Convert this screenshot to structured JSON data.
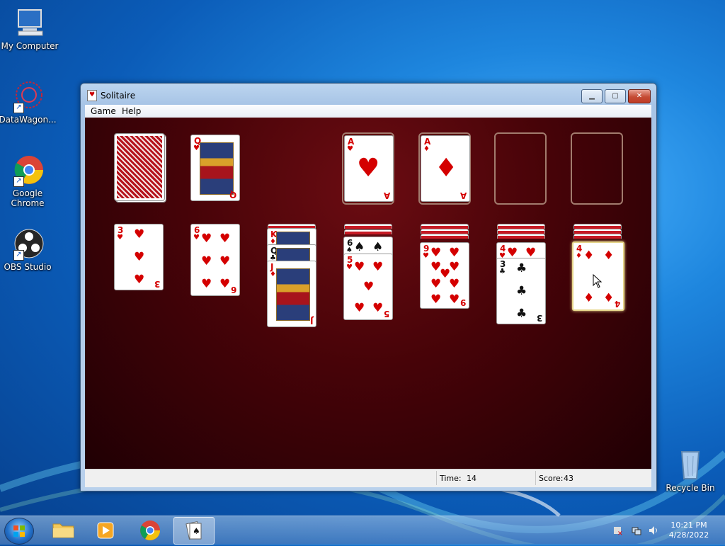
{
  "desktop": {
    "icons": [
      {
        "label": "My Computer"
      },
      {
        "label": "DataWagon..."
      },
      {
        "label": "Google Chrome"
      },
      {
        "label": "OBS Studio"
      },
      {
        "label": "Recycle Bin"
      }
    ]
  },
  "window": {
    "title": "Solitaire",
    "menu": [
      "Game",
      "Help"
    ],
    "controls": {
      "minimize": "▁",
      "maximize": "▢",
      "close": "✕"
    }
  },
  "game": {
    "stock": "face-down deck",
    "waste": {
      "rank": "Q",
      "suit": "♥"
    },
    "foundations": [
      {
        "rank": "A",
        "suit": "♥"
      },
      {
        "rank": "A",
        "suit": "♦"
      },
      null,
      null
    ],
    "tableau": [
      {
        "hidden": 0,
        "up": [
          {
            "rank": "3",
            "suit": "♥"
          }
        ]
      },
      {
        "hidden": 0,
        "up": [
          {
            "rank": "6",
            "suit": "♥"
          }
        ]
      },
      {
        "hidden": 1,
        "up": [
          {
            "rank": "K",
            "suit": "♦"
          },
          {
            "rank": "Q",
            "suit": "♣"
          },
          {
            "rank": "J",
            "suit": "♦"
          }
        ]
      },
      {
        "hidden": 2,
        "up": [
          {
            "rank": "6",
            "suit": "♠"
          },
          {
            "rank": "5",
            "suit": "♥"
          }
        ]
      },
      {
        "hidden": 3,
        "up": [
          {
            "rank": "9",
            "suit": "♥"
          }
        ]
      },
      {
        "hidden": 3,
        "up": [
          {
            "rank": "4",
            "suit": "♥"
          },
          {
            "rank": "3",
            "suit": "♣"
          }
        ]
      },
      {
        "hidden": 3,
        "up": [
          {
            "rank": "4",
            "suit": "♦"
          }
        ]
      }
    ]
  },
  "status": {
    "time_label": "Time:",
    "time_value": "14",
    "score_label": "Score:",
    "score_value": "43"
  },
  "taskbar": {
    "clock_time": "10:21 PM",
    "clock_date": "4/28/2022"
  }
}
